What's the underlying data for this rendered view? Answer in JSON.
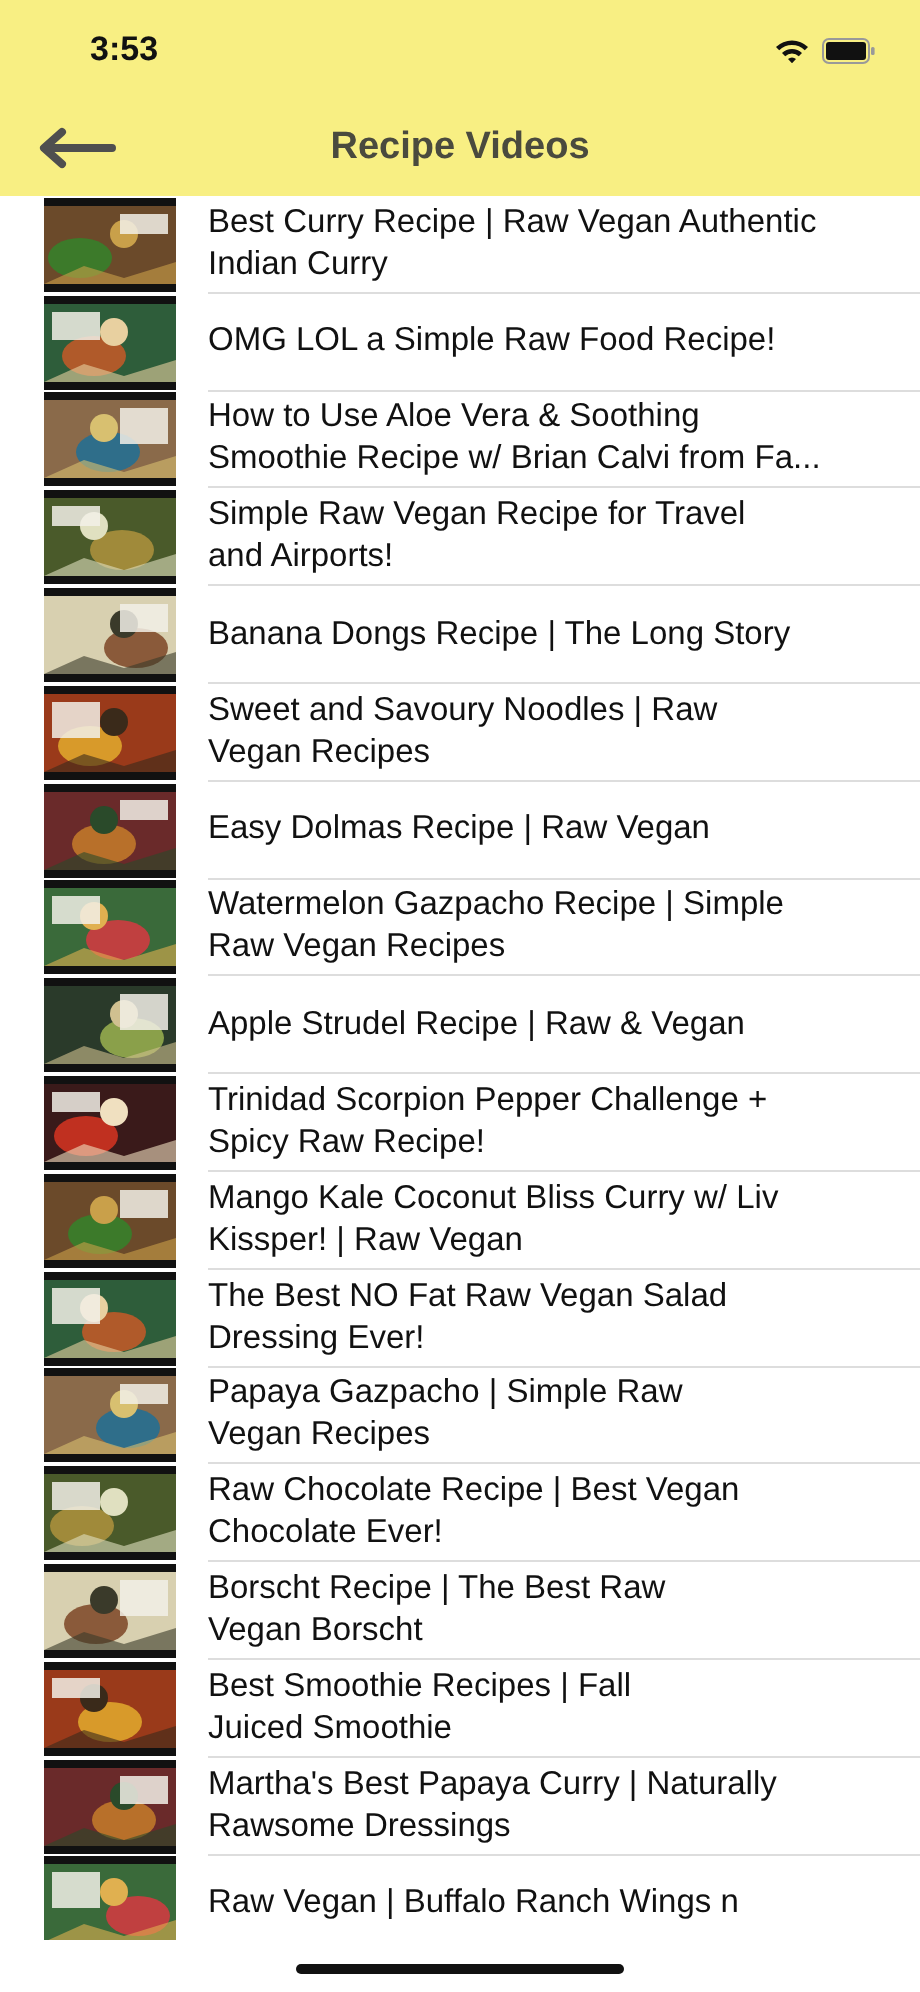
{
  "status_bar": {
    "time": "3:53"
  },
  "nav_bar": {
    "title": "Recipe Videos"
  },
  "videos": [
    {
      "title": "Best Curry Recipe | Raw Vegan Authentic\nIndian Curry"
    },
    {
      "title": "OMG LOL a Simple Raw Food Recipe!"
    },
    {
      "title": "How to Use Aloe Vera & Soothing\nSmoothie Recipe w/ Brian Calvi from Fa..."
    },
    {
      "title": "Simple Raw Vegan Recipe for Travel\nand Airports!"
    },
    {
      "title": "Banana Dongs Recipe | The Long Story"
    },
    {
      "title": "Sweet and Savoury Noodles | Raw\nVegan Recipes"
    },
    {
      "title": "Easy Dolmas Recipe | Raw Vegan"
    },
    {
      "title": "Watermelon Gazpacho Recipe | Simple\nRaw Vegan Recipes"
    },
    {
      "title": "Apple Strudel Recipe | Raw & Vegan"
    },
    {
      "title": "Trinidad Scorpion Pepper Challenge +\nSpicy Raw Recipe!"
    },
    {
      "title": "Mango Kale Coconut Bliss Curry w/ Liv\nKissper! | Raw Vegan"
    },
    {
      "title": "The Best NO Fat Raw Vegan Salad\nDressing Ever!"
    },
    {
      "title": "Papaya Gazpacho | Simple Raw\nVegan Recipes"
    },
    {
      "title": "Raw Chocolate Recipe | Best Vegan\nChocolate Ever!"
    },
    {
      "title": "Borscht Recipe | The Best Raw\nVegan Borscht"
    },
    {
      "title": "Best Smoothie Recipes | Fall\nJuiced Smoothie"
    },
    {
      "title": "Martha's Best Papaya Curry | Naturally\nRawsome Dressings"
    },
    {
      "title": "Raw Vegan | Buffalo Ranch Wings n"
    }
  ]
}
